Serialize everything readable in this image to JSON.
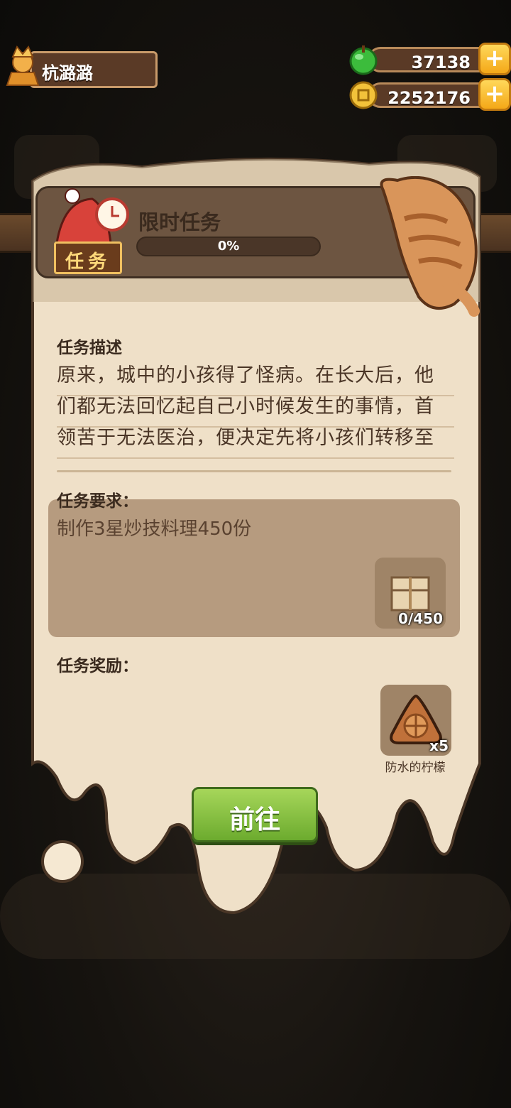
{
  "player": {
    "name": "杭潞潞"
  },
  "currency": [
    {
      "icon": "green-gem-icon",
      "value": "37138"
    },
    {
      "icon": "gold-coin-icon",
      "value": "2252176"
    }
  ],
  "task": {
    "badge": "任务",
    "title": "限时任务",
    "progress_text": "0%",
    "progress_value": 0,
    "description_label": "任务描述",
    "description_lines": [
      "原来，城中的小孩得了怪病。在长大后，他",
      "们都无法回忆起自己小时候发生的事情，首",
      "领苦于无法医治，便决定先将小孩们转移至"
    ],
    "requirement_label": "任务要求：",
    "requirement_text": "制作3星炒技料理450份",
    "requirement_item": {
      "icon": "package-icon",
      "count": "0/450"
    },
    "reward_label": "任务奖励：",
    "reward_item": {
      "icon": "lemon-triangle-icon",
      "count": "x5",
      "name": "防水的柠檬"
    },
    "go_button": "前往"
  },
  "colors": {
    "panel": "#efe0c8",
    "accent_green": "#7ec23c",
    "wood": "#6d5541"
  }
}
